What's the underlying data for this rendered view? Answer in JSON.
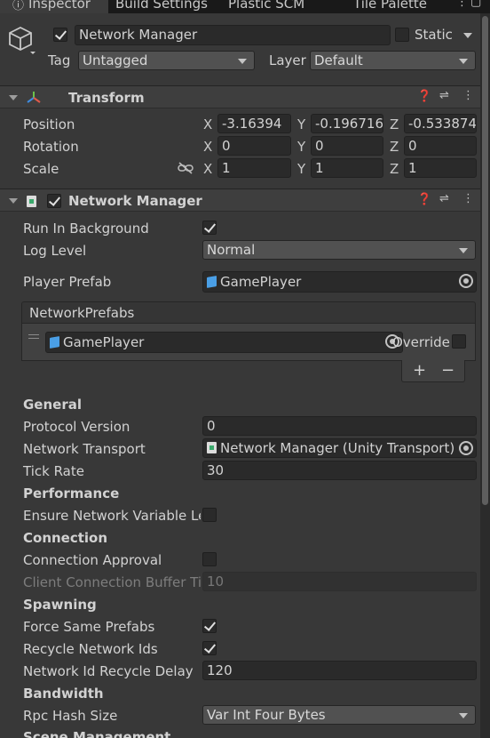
{
  "tabs": [
    {
      "label": "Inspector",
      "active": true
    },
    {
      "label": "Build Settings",
      "active": false
    },
    {
      "label": "Plastic SCM",
      "active": false
    },
    {
      "label": "Tile Palette",
      "active": false
    }
  ],
  "object": {
    "name": "Network Manager",
    "active": true,
    "static_label": "Static",
    "static_checked": false,
    "tag_label": "Tag",
    "tag_value": "Untagged",
    "layer_label": "Layer",
    "layer_value": "Default"
  },
  "transform": {
    "title": "Transform",
    "position_label": "Position",
    "rotation_label": "Rotation",
    "scale_label": "Scale",
    "axes": {
      "x": "X",
      "y": "Y",
      "z": "Z"
    },
    "position": {
      "x": "-3.16394",
      "y": "-0.196716",
      "z": "-0.533874"
    },
    "rotation": {
      "x": "0",
      "y": "0",
      "z": "0"
    },
    "scale": {
      "x": "1",
      "y": "1",
      "z": "1"
    }
  },
  "network_manager": {
    "title": "Network Manager",
    "enabled": true,
    "run_in_background_label": "Run In Background",
    "run_in_background": true,
    "log_level_label": "Log Level",
    "log_level": "Normal",
    "player_prefab_label": "Player Prefab",
    "player_prefab": "GamePlayer",
    "network_prefabs_label": "NetworkPrefabs",
    "network_prefabs": [
      {
        "name": "GamePlayer",
        "override_label": "Override",
        "override": false
      }
    ],
    "add_label": "+",
    "remove_label": "−",
    "general_header": "General",
    "protocol_version_label": "Protocol Version",
    "protocol_version": "0",
    "network_transport_label": "Network Transport",
    "network_transport": "Network Manager (Unity Transport)",
    "tick_rate_label": "Tick Rate",
    "tick_rate": "30",
    "performance_header": "Performance",
    "ensure_nv_label": "Ensure Network Variable Le",
    "ensure_nv": false,
    "connection_header": "Connection",
    "connection_approval_label": "Connection Approval",
    "connection_approval": false,
    "client_buffer_label": "Client Connection Buffer Tir",
    "client_buffer": "10",
    "spawning_header": "Spawning",
    "force_same_prefabs_label": "Force Same Prefabs",
    "force_same_prefabs": true,
    "recycle_ids_label": "Recycle Network Ids",
    "recycle_ids": true,
    "recycle_delay_label": "Network Id Recycle Delay",
    "recycle_delay": "120",
    "bandwidth_header": "Bandwidth",
    "rpc_hash_label": "Rpc Hash Size",
    "rpc_hash": "Var Int Four Bytes",
    "scene_management_header": "Scene Management"
  },
  "colors": {
    "background": "#383838",
    "field": "#2a2a2a",
    "accent_prefab": "#4a9fe6"
  }
}
